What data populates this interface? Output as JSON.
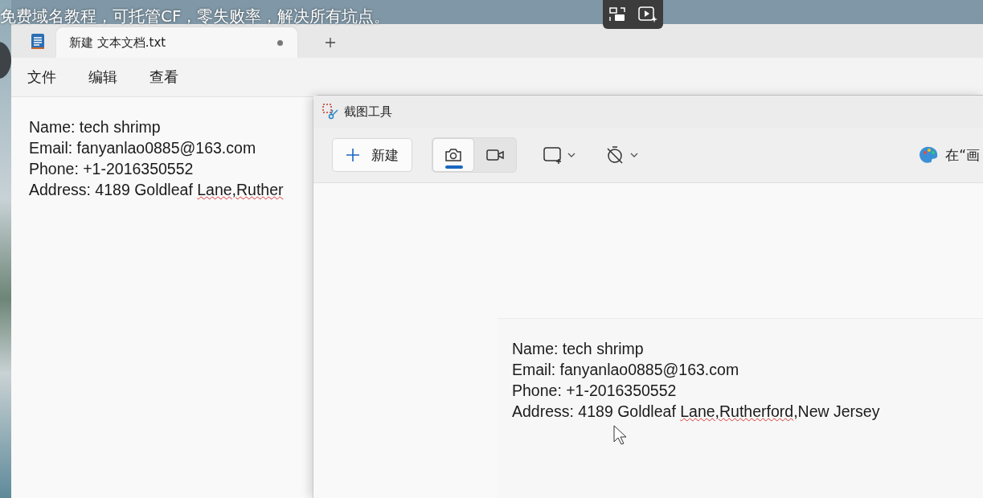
{
  "video_caption": "免费域名教程，可托管CF，零失败率，解决所有坑点。",
  "notepad": {
    "tab": {
      "title": "新建 文本文档.txt",
      "modified": true,
      "selected": true
    },
    "menu": [
      "文件",
      "编辑",
      "查看"
    ],
    "lines": [
      [
        {
          "text": "Name: tech shrimp",
          "misspelled": false
        }
      ],
      [
        {
          "text": "Email: fanyanlao0885@163.com",
          "misspelled": false
        }
      ],
      [
        {
          "text": "Phone: +1-2016350552",
          "misspelled": false
        }
      ],
      [
        {
          "text": "Address: 4189 Goldleaf ",
          "misspelled": false
        },
        {
          "text": "Lane,Ruther",
          "misspelled": true
        }
      ]
    ]
  },
  "snipping_tool": {
    "title": "截图工具",
    "new_button": "新建",
    "modes": [
      {
        "kind": "photo",
        "selected": true
      },
      {
        "kind": "video",
        "selected": false
      }
    ],
    "paint_label": "在“画",
    "capture_lines": [
      [
        {
          "text": "Name: tech shrimp",
          "misspelled": false
        }
      ],
      [
        {
          "text": "Email: fanyanlao0885@163.com",
          "misspelled": false
        }
      ],
      [
        {
          "text": "Phone: +1-2016350552",
          "misspelled": false
        }
      ],
      [
        {
          "text": "Address: 4189 Goldleaf ",
          "misspelled": false
        },
        {
          "text": "Lane,Rutherford",
          "misspelled": true
        },
        {
          "text": ",New Jersey",
          "misspelled": false
        }
      ]
    ]
  }
}
